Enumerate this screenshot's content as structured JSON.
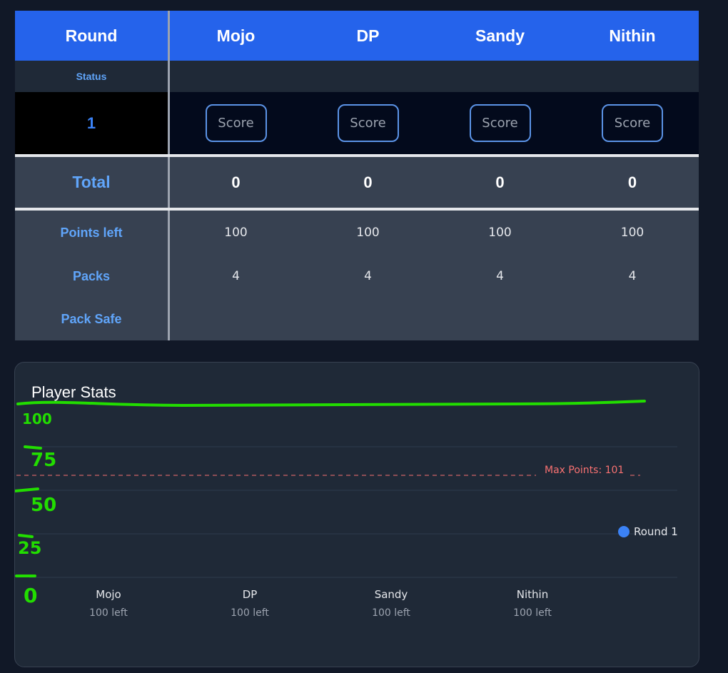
{
  "table": {
    "header": {
      "round_label": "Round",
      "players": [
        "Mojo",
        "DP",
        "Sandy",
        "Nithin"
      ]
    },
    "status_label": "Status",
    "rounds": [
      {
        "number": "1",
        "score_placeholder": "Score"
      }
    ],
    "total": {
      "label": "Total",
      "values": [
        "0",
        "0",
        "0",
        "0"
      ]
    },
    "points_left": {
      "label": "Points left",
      "values": [
        "100",
        "100",
        "100",
        "100"
      ]
    },
    "packs": {
      "label": "Packs",
      "values": [
        "4",
        "4",
        "4",
        "4"
      ]
    },
    "pack_safe": {
      "label": "Pack Safe"
    }
  },
  "stats": {
    "title": "Player Stats",
    "max_line_label": "Max Points: 101",
    "legend": [
      {
        "label": "Round 1",
        "color": "#3b82f6"
      }
    ],
    "players": [
      {
        "name": "Mojo",
        "left": "100 left"
      },
      {
        "name": "DP",
        "left": "100 left"
      },
      {
        "name": "Sandy",
        "left": "100 left"
      },
      {
        "name": "Nithin",
        "left": "100 left"
      }
    ],
    "annotations": [
      "100",
      "75",
      "50",
      "25",
      "0"
    ]
  },
  "chart_data": {
    "type": "bar",
    "categories": [
      "Mojo",
      "DP",
      "Sandy",
      "Nithin"
    ],
    "series": [
      {
        "name": "Round 1",
        "values": [
          0,
          0,
          0,
          0
        ]
      }
    ],
    "ylim": [
      0,
      100
    ],
    "reference_line": {
      "label": "Max Points: 101",
      "value": 101
    },
    "colors": {
      "round1": "#3b82f6",
      "max_line": "#f87171",
      "annotation": "#22dd00"
    }
  }
}
